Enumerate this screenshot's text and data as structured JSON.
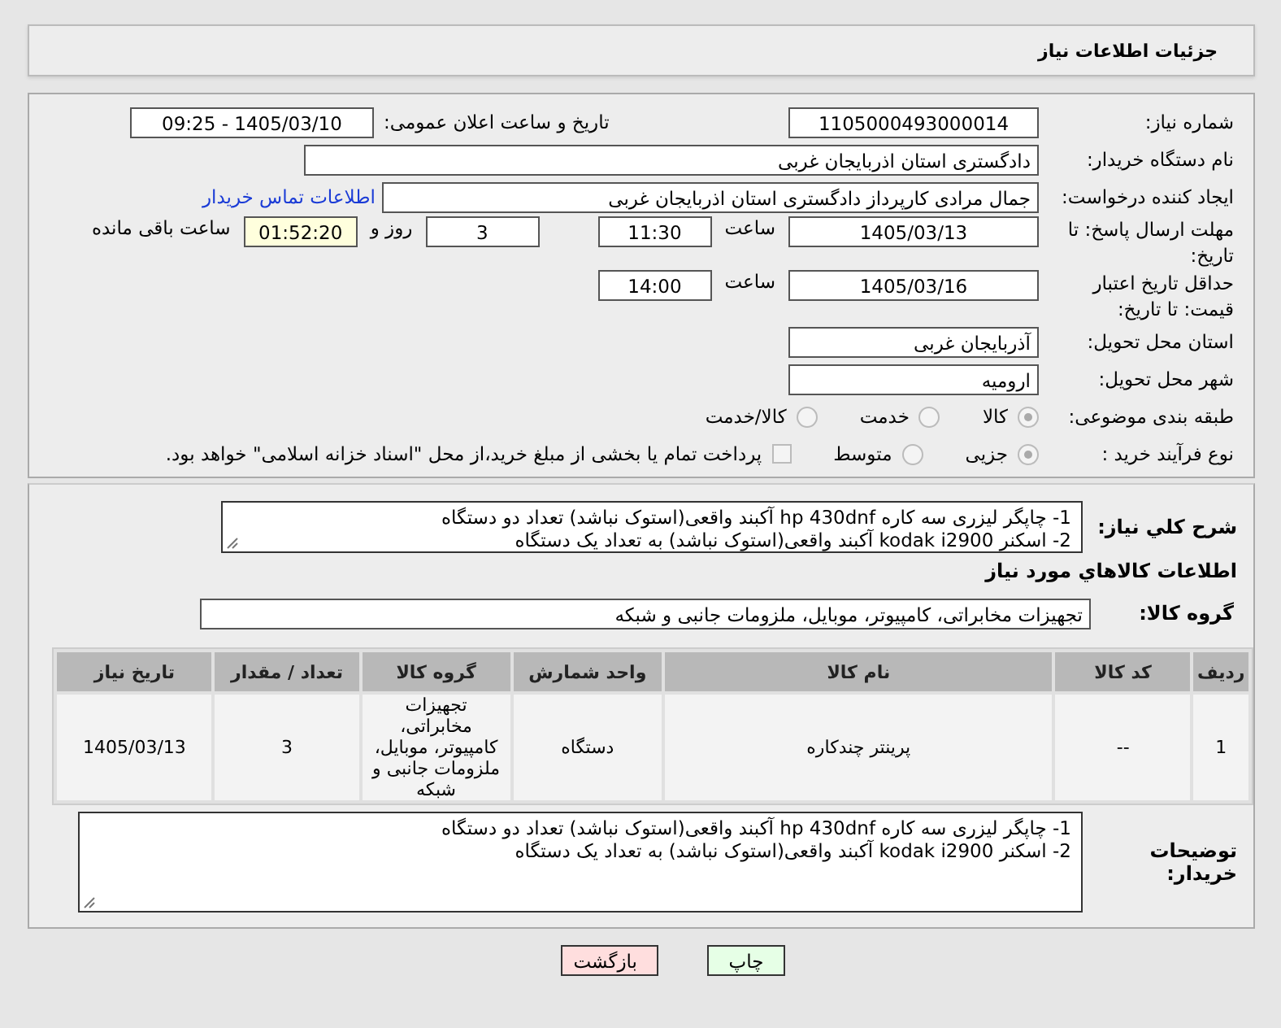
{
  "header": {
    "title": "جزئیات اطلاعات نیاز"
  },
  "need_number": {
    "label": "شماره نیاز:",
    "value": "1105000493000014"
  },
  "announce": {
    "label": "تاریخ و ساعت اعلان عمومی:",
    "value": "1405/03/10 - 09:25"
  },
  "buyer": {
    "label": "نام دستگاه خریدار:",
    "value": "دادگستری استان اذربایجان غربی"
  },
  "requester": {
    "label": "ایجاد کننده درخواست:",
    "value": "جمال مرادی کارپرداز دادگستری استان اذربایجان غربی",
    "link": "اطلاعات تماس خریدار"
  },
  "deadline": {
    "label": "مهلت ارسال پاسخ: تا تاریخ:",
    "date": "1405/03/13",
    "time_label": "ساعت",
    "time": "11:30",
    "days": "3",
    "days_label": "روز و",
    "remaining": "01:52:20",
    "remaining_label": "ساعت باقی مانده"
  },
  "validity": {
    "label": "حداقل تاریخ اعتبار قیمت: تا تاریخ:",
    "date": "1405/03/16",
    "time_label": "ساعت",
    "time": "14:00"
  },
  "province": {
    "label": "استان محل تحویل:",
    "value": "آذربایجان غربی"
  },
  "city": {
    "label": "شهر محل تحویل:",
    "value": "ارومیه"
  },
  "category": {
    "label": "طبقه بندی موضوعی:",
    "options": [
      {
        "label": "کالا",
        "selected": true
      },
      {
        "label": "خدمت",
        "selected": false
      },
      {
        "label": "کالا/خدمت",
        "selected": false
      }
    ]
  },
  "process": {
    "label": "نوع فرآیند خرید :",
    "options": [
      {
        "label": "جزیی",
        "selected": true
      },
      {
        "label": "متوسط",
        "selected": false
      }
    ],
    "payment": {
      "checked": false,
      "label": "پرداخت تمام یا بخشی از مبلغ خرید،از محل \"اسناد خزانه اسلامی\" خواهد بود."
    }
  },
  "description": {
    "label": "شرح کلي نياز:",
    "lines": [
      "1- چاپگر لیزری سه کاره hp 430dnf  آکبند واقعی(استوک نباشد) تعداد دو دستگاه",
      "2- اسکنر kodak i2900 آکبند واقعی(استوک نباشد) به تعداد یک دستگاه"
    ]
  },
  "goods_title": "اطلاعات کالاهاي مورد نياز",
  "group": {
    "label": "گروه کالا:",
    "value": "تجهیزات مخابراتی، کامپیوتر، موبایل، ملزومات جانبی و شبکه"
  },
  "table": {
    "columns": [
      "ردیف",
      "کد کالا",
      "نام کالا",
      "واحد شمارش",
      "گروه کالا",
      "تعداد / مقدار",
      "تاریخ نیاز"
    ],
    "rows": [
      [
        "1",
        "--",
        "پرینتر چندکاره",
        "دستگاه",
        "تجهیزات مخابراتی، کامپیوتر، موبایل، ملزومات جانبی و شبکه",
        "3",
        "1405/03/13"
      ]
    ]
  },
  "buyer_notes": {
    "label": "توضیحات خریدار:",
    "lines": [
      "1- چاپگر لیزری سه کاره hp 430dnf  آکبند واقعی(استوک نباشد) تعداد دو دستگاه",
      "2- اسکنر kodak i2900 آکبند واقعی(استوک نباشد) به تعداد یک دستگاه"
    ]
  },
  "buttons": [
    {
      "label": "چاپ",
      "kind": "print"
    },
    {
      "label": "بازگشت",
      "kind": "back"
    }
  ]
}
